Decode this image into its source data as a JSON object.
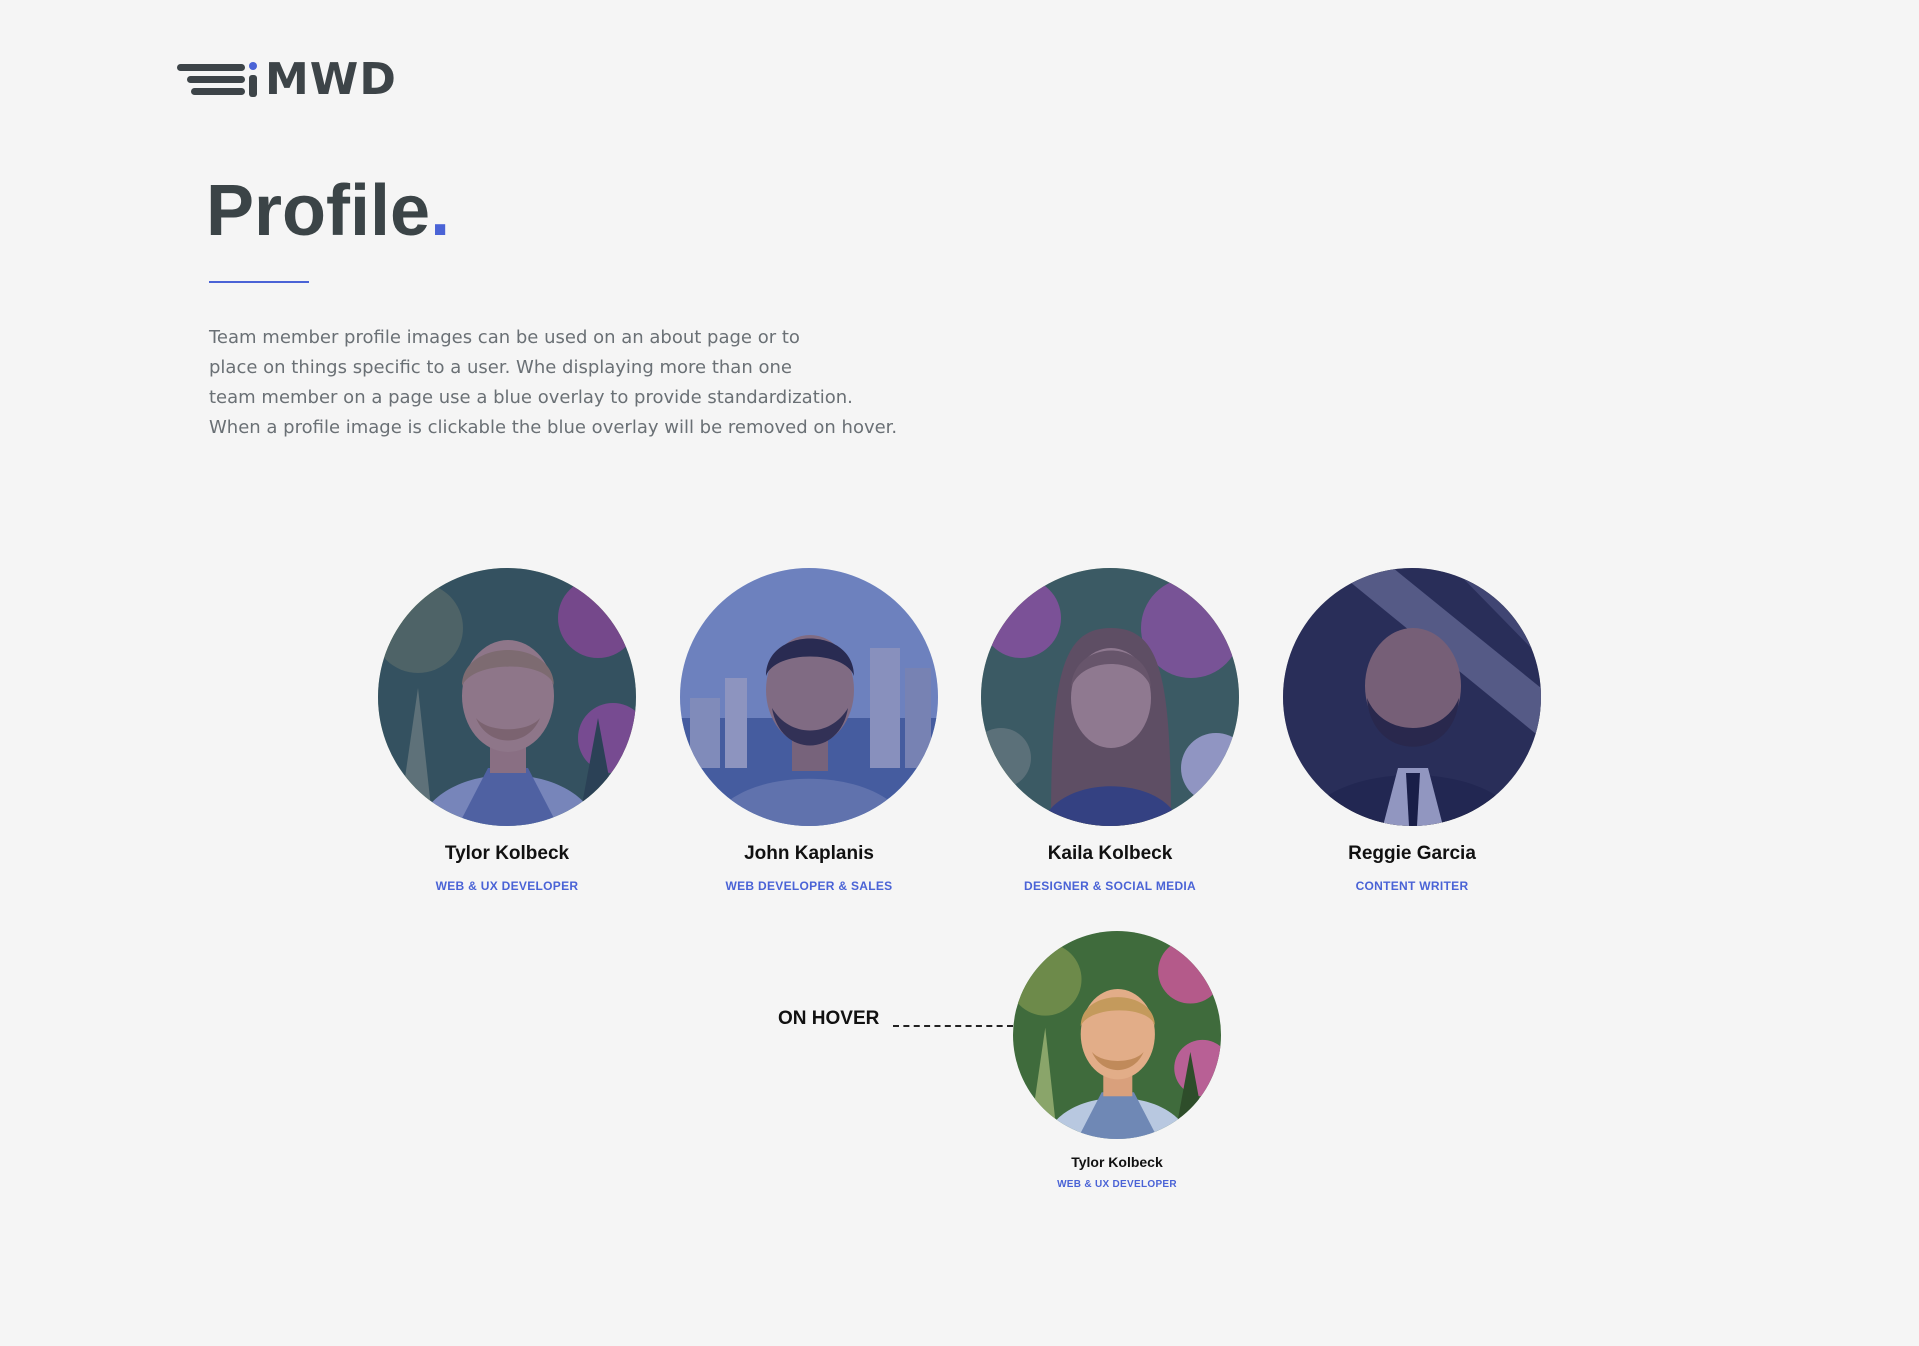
{
  "brand": {
    "logo_text": "MWD",
    "accent_color": "#4a63d6",
    "text_color": "#3b4447"
  },
  "page": {
    "title": "Profile",
    "title_period": ".",
    "description_lines": [
      "Team member profile images can be used on an about page or to",
      "place on things specific to a user. Whe displaying more than one",
      "team member on a page use a blue overlay to provide standardization.",
      "When a profile image is clickable the blue overlay will be removed on hover."
    ]
  },
  "team": [
    {
      "name": "Tylor Kolbeck",
      "role": "WEB & UX DEVELOPER",
      "overlay": true
    },
    {
      "name": "John Kaplanis",
      "role": "WEB DEVELOPER & SALES",
      "overlay": true
    },
    {
      "name": "Kaila Kolbeck",
      "role": "DESIGNER & SOCIAL MEDIA",
      "overlay": true
    },
    {
      "name": "Reggie Garcia",
      "role": "CONTENT WRITER",
      "overlay": true
    }
  ],
  "hover_example": {
    "label": "ON HOVER",
    "name": "Tylor Kolbeck",
    "role": "WEB & UX DEVELOPER",
    "overlay": false
  }
}
